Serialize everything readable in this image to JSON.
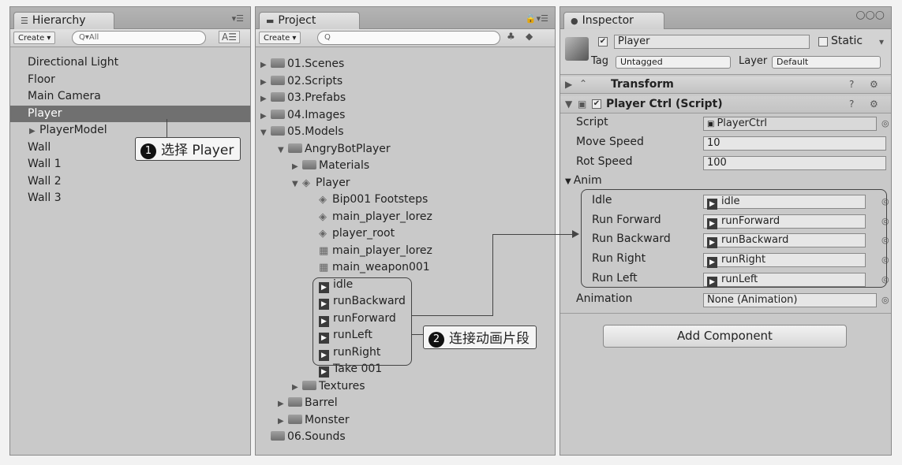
{
  "hierarchy": {
    "tab": "Hierarchy",
    "create": "Create ▾",
    "search": "Q▾All",
    "items": [
      "Directional Light",
      "Floor",
      "Main Camera",
      "Player",
      "PlayerModel",
      "Wall",
      "Wall 1",
      "Wall 2",
      "Wall 3"
    ]
  },
  "project": {
    "tab": "Project",
    "create": "Create ▾",
    "search": "Q",
    "items": [
      "01.Scenes",
      "02.Scripts",
      "03.Prefabs",
      "04.Images",
      "05.Models",
      "AngryBotPlayer",
      "Materials",
      "Player",
      "Bip001 Footsteps",
      "main_player_lorez",
      "player_root",
      "main_player_lorez",
      "main_weapon001",
      "idle",
      "runBackward",
      "runForward",
      "runLeft",
      "runRight",
      "Take 001",
      "Textures",
      "Barrel",
      "Monster",
      "06.Sounds"
    ]
  },
  "inspector": {
    "tab": "Inspector",
    "object_name": "Player",
    "static_label": "Static",
    "tag_label": "Tag",
    "tag_value": "Untagged",
    "layer_label": "Layer",
    "layer_value": "Default",
    "transform": "Transform",
    "script_component": "Player Ctrl (Script)",
    "script_label": "Script",
    "script_value": "PlayerCtrl",
    "move_speed_label": "Move Speed",
    "move_speed": "10",
    "rot_speed_label": "Rot Speed",
    "rot_speed": "100",
    "anim_label": "Anim",
    "anim_fields": [
      {
        "label": "Idle",
        "value": "idle"
      },
      {
        "label": "Run Forward",
        "value": "runForward"
      },
      {
        "label": "Run Backward",
        "value": "runBackward"
      },
      {
        "label": "Run Right",
        "value": "runRight"
      },
      {
        "label": "Run Left",
        "value": "runLeft"
      }
    ],
    "animation_label": "Animation",
    "animation_value": "None (Animation)",
    "add_component": "Add Component"
  },
  "callouts": {
    "one_num": "1",
    "one_text": "选择 Player",
    "two_num": "2",
    "two_text": "连接动画片段"
  },
  "colors": {
    "selection": "#707070",
    "panel": "#c9c9c9"
  }
}
